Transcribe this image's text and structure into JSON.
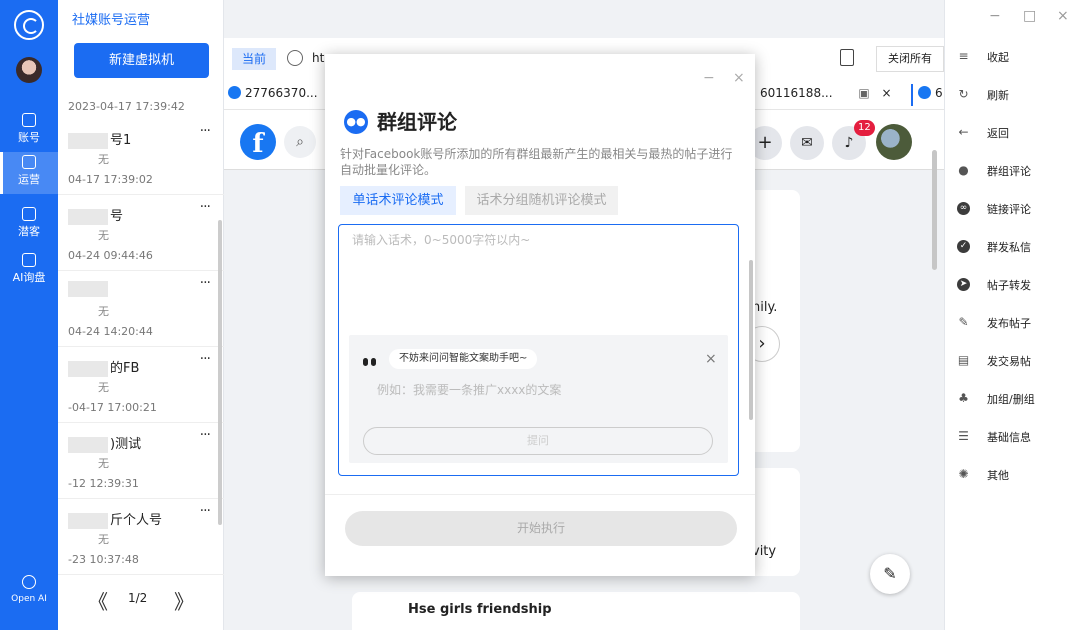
{
  "app": {
    "title": "社媒账号运营"
  },
  "nav": [
    {
      "label": "账号",
      "icon": "facebook-icon",
      "active": false
    },
    {
      "label": "运营",
      "icon": "operate-icon",
      "active": true
    },
    {
      "label": "潜客",
      "icon": "leads-icon",
      "active": false
    },
    {
      "label": "AI询盘",
      "icon": "ai-icon",
      "active": false
    }
  ],
  "bottom_nav": {
    "label": "Open AI"
  },
  "accounts": {
    "new_button": "新建虚拟机",
    "first_time": "2023-04-17 17:39:42",
    "items": [
      {
        "name": "号1",
        "tag": "无",
        "time": "04-17 17:39:02",
        "more": "···"
      },
      {
        "name": "号",
        "tag": "无",
        "time": "04-24 09:44:46",
        "more": "···"
      },
      {
        "name": "",
        "tag": "无",
        "time": "04-24 14:20:44",
        "more": "···"
      },
      {
        "name": "的FB",
        "tag": "无",
        "time": "-04-17 17:00:21",
        "more": "···"
      },
      {
        "name": ")测试",
        "tag": "无",
        "time": "-12 12:39:31",
        "more": "···"
      },
      {
        "name": "斤个人号",
        "tag": "无",
        "time": "-23 10:37:48",
        "more": "···"
      }
    ],
    "page": "1/2",
    "prev": "《",
    "next": "》"
  },
  "browser": {
    "current": "当前",
    "url": "ht",
    "close_all": "关闭所有",
    "tabs": [
      "27766370...",
      "60116188...",
      "6"
    ],
    "tab_close": "×",
    "post_texts": {
      "a": "nily.",
      "b": "vity",
      "c": "Hse girls friendship"
    },
    "badge": "12"
  },
  "modal": {
    "title": "群组评论",
    "description": "针对Facebook账号所添加的所有群组最新产生的最相关与最热的帖子进行自动批量化评论。",
    "mode_single": "单话术评论模式",
    "mode_random": "话术分组随机评论模式",
    "textarea_placeholder": "请输入话术，0~5000字符以内~",
    "assistant_bubble": "不妨来问问智能文案助手吧~",
    "assistant_hint": "例如：我需要一条推广xxxx的文案",
    "ask_button": "提问",
    "execute_button": "开始执行",
    "minimize": "−",
    "close": "×"
  },
  "side_menu": [
    {
      "label": "收起",
      "icon": "collapse-icon"
    },
    {
      "label": "刷新",
      "icon": "refresh-icon"
    },
    {
      "label": "返回",
      "icon": "back-icon"
    },
    {
      "label": "群组评论",
      "icon": "group-icon"
    },
    {
      "label": "链接评论",
      "icon": "link-icon"
    },
    {
      "label": "群发私信",
      "icon": "message-icon"
    },
    {
      "label": "帖子转发",
      "icon": "share-icon"
    },
    {
      "label": "发布帖子",
      "icon": "edit-icon"
    },
    {
      "label": "发交易帖",
      "icon": "store-icon"
    },
    {
      "label": "加组/删组",
      "icon": "group-edit-icon"
    },
    {
      "label": "基础信息",
      "icon": "sliders-icon"
    },
    {
      "label": "其他",
      "icon": "gear-icon"
    }
  ],
  "window": {
    "minimize": "−",
    "maximize": "□",
    "close": "×"
  },
  "colors": {
    "accent": "#1b6cf2",
    "facebook": "#1877f2",
    "badge": "#e41e3f"
  }
}
